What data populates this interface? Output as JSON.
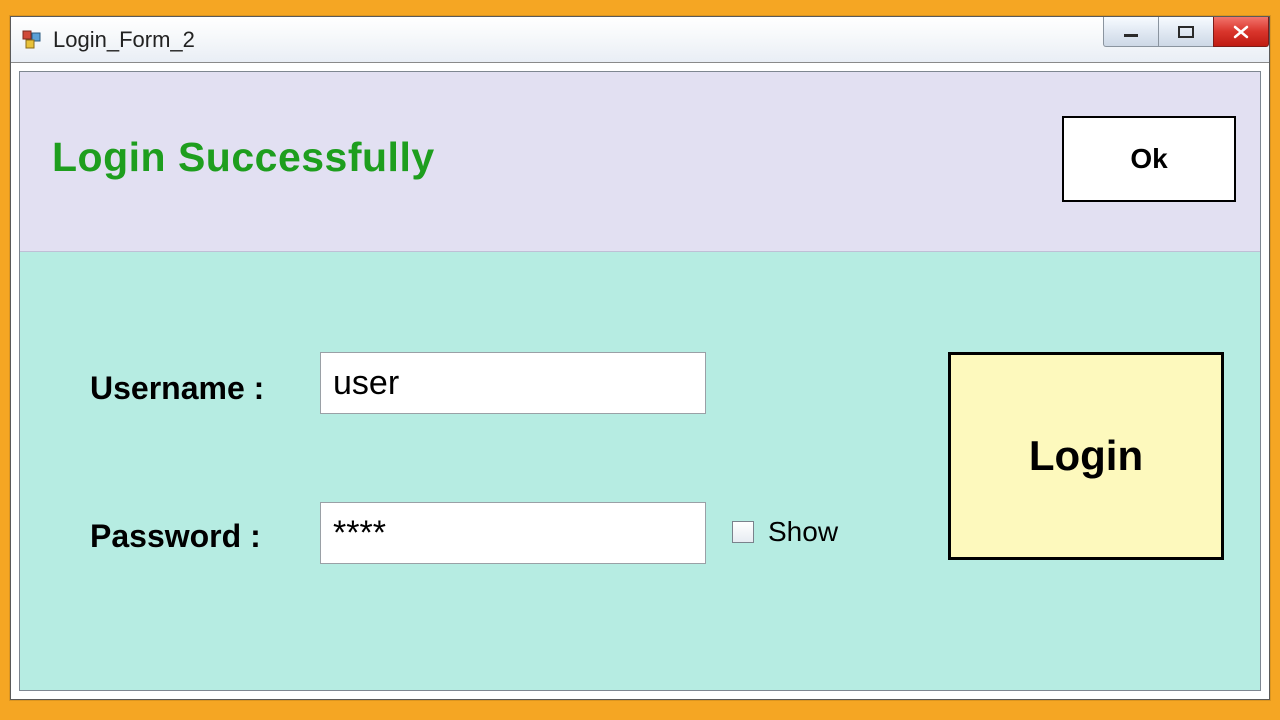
{
  "window": {
    "title": "Login_Form_2"
  },
  "notice": {
    "message": "Login Successfully",
    "ok_label": "Ok"
  },
  "form": {
    "username_label": "Username :",
    "username_value": "user",
    "password_label": "Password :",
    "password_value": "****",
    "show_label": "Show",
    "show_checked": false,
    "login_label": "Login"
  },
  "colors": {
    "page_bg": "#f5a623",
    "notice_bg": "#e2e0f2",
    "form_bg": "#b6ece2",
    "success_text": "#1e9e1e",
    "login_btn_bg": "#fdf9bd"
  }
}
